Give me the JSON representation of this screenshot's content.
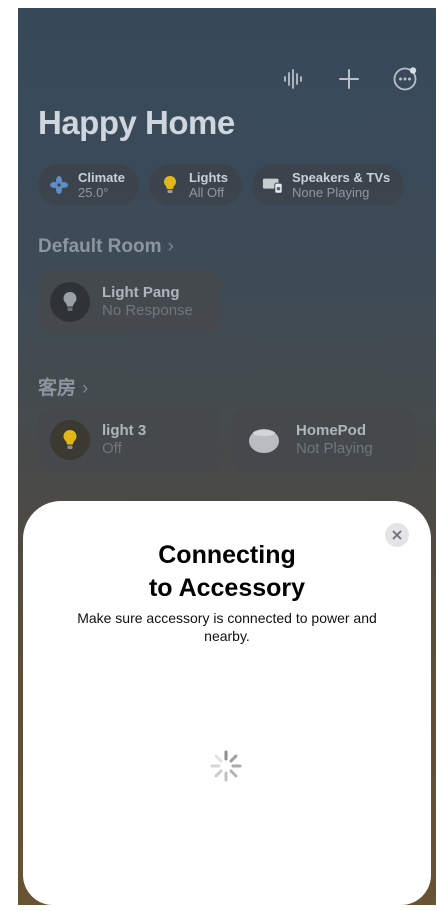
{
  "home": {
    "title": "Happy Home",
    "top_icons": [
      "voice-waveform-icon",
      "plus-icon",
      "more-icon"
    ],
    "chips": [
      {
        "icon": "fan-icon",
        "label": "Climate",
        "value": "25.0°"
      },
      {
        "icon": "bulb-icon",
        "label": "Lights",
        "value": "All Off"
      },
      {
        "icon": "tv-speaker-icon",
        "label": "Speakers & TVs",
        "value": "None Playing"
      }
    ],
    "rooms": [
      {
        "name": "Default Room",
        "tiles": [
          {
            "icon": "bulb-icon",
            "name": "Light Pang",
            "status": "No Response"
          }
        ]
      },
      {
        "name": "客房",
        "tiles": [
          {
            "icon": "bulb-icon",
            "name": "light 3",
            "status": "Off"
          },
          {
            "icon": "homepod-icon",
            "name": "HomePod",
            "status": "Not Playing"
          }
        ]
      }
    ]
  },
  "sheet": {
    "title_line1": "Connecting",
    "title_line2": "to Accessory",
    "subtitle": "Make sure accessory is connected to power and nearby.",
    "close_icon": "close-icon"
  },
  "colors": {
    "accent_yellow": "#e2b616",
    "sheet_bg": "#ffffff"
  }
}
